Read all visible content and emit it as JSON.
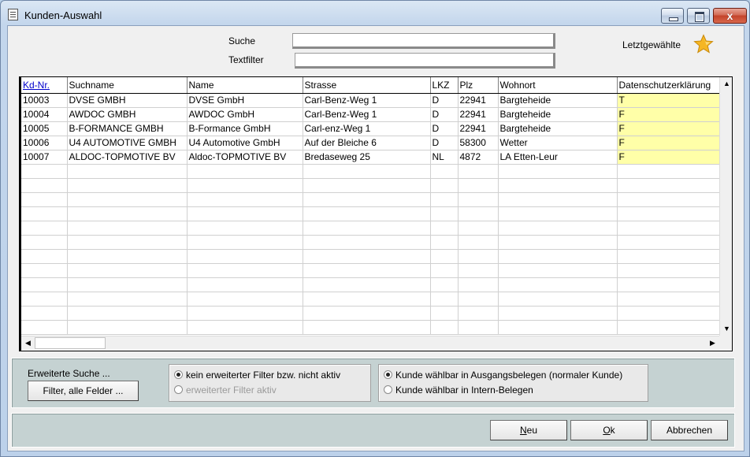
{
  "window": {
    "title": "Kunden-Auswahl"
  },
  "titlebar": {
    "close_glyph": "x"
  },
  "search": {
    "label": "Suche",
    "value": ""
  },
  "textfilter": {
    "label": "Textfilter",
    "value": ""
  },
  "favorites": {
    "label": "Letztgewählte",
    "icon": "star-icon",
    "color": "#f5b623"
  },
  "grid": {
    "columns": [
      "Kd-Nr.",
      "Suchname",
      "Name",
      "Strasse",
      "LKZ",
      "Plz",
      "Wohnort",
      "Datenschutzerklärung"
    ],
    "rows": [
      [
        "10003",
        "DVSE GMBH",
        "DVSE GmbH",
        "Carl-Benz-Weg 1",
        "D",
        "22941",
        "Bargteheide",
        "T"
      ],
      [
        "10004",
        "AWDOC GMBH",
        "AWDOC GmbH",
        "Carl-Benz-Weg 1",
        "D",
        "22941",
        "Bargteheide",
        "F"
      ],
      [
        "10005",
        "B-FORMANCE GMBH",
        "B-Formance GmbH",
        "Carl-enz-Weg 1",
        "D",
        "22941",
        "Bargteheide",
        "F"
      ],
      [
        "10006",
        "U4 AUTOMOTIVE GMBH",
        "U4 Automotive GmbH",
        "Auf der Bleiche 6",
        "D",
        "58300",
        "Wetter",
        "F"
      ],
      [
        "10007",
        "ALDOC-TOPMOTIVE BV",
        "Aldoc-TOPMOTIVE BV",
        "Bredaseweg 25",
        "NL",
        "4872",
        "LA Etten-Leur",
        "F"
      ]
    ],
    "highlight_color": "#ffffa8",
    "sort_link_color": "#0000cc"
  },
  "advanced": {
    "label": "Erweiterte Suche ...",
    "button_label": "Filter, alle Felder ..."
  },
  "filter_options": {
    "option1": "kein erweiterter Filter bzw. nicht aktiv",
    "option2": "erweiterter Filter aktiv",
    "selected": "option1"
  },
  "customer_options": {
    "option1": "Kunde wählbar in Ausgangsbelegen (normaler Kunde)",
    "option2": "Kunde wählbar in Intern-Belegen",
    "selected": "option1"
  },
  "buttons": {
    "new_first": "N",
    "new_rest": "eu",
    "ok_first": "O",
    "ok_rest": "k",
    "cancel": "Abbrechen"
  }
}
